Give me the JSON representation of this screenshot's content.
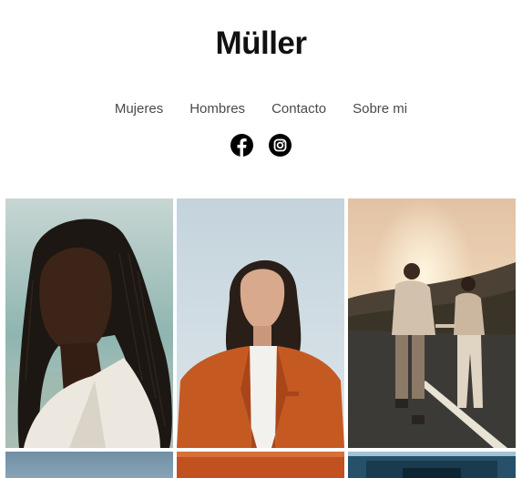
{
  "site": {
    "title": "Müller"
  },
  "nav": {
    "items": [
      {
        "label": "Mujeres"
      },
      {
        "label": "Hombres"
      },
      {
        "label": "Contacto"
      },
      {
        "label": "Sobre mi"
      }
    ]
  },
  "social": [
    {
      "icon": "facebook-icon"
    },
    {
      "icon": "instagram-icon"
    }
  ],
  "gallery": {
    "photos": [
      {
        "subject": "woman-braids-portrait"
      },
      {
        "subject": "woman-orange-blazer-portrait"
      },
      {
        "subject": "couple-walking-sunset"
      },
      {
        "subject": "cropped-sky-photo"
      },
      {
        "subject": "cropped-orange-photo"
      },
      {
        "subject": "cropped-blue-interior-photo"
      }
    ]
  },
  "colors": {
    "text": "#111111",
    "nav": "#4a4a4a",
    "accent_orange": "#c45a22"
  }
}
